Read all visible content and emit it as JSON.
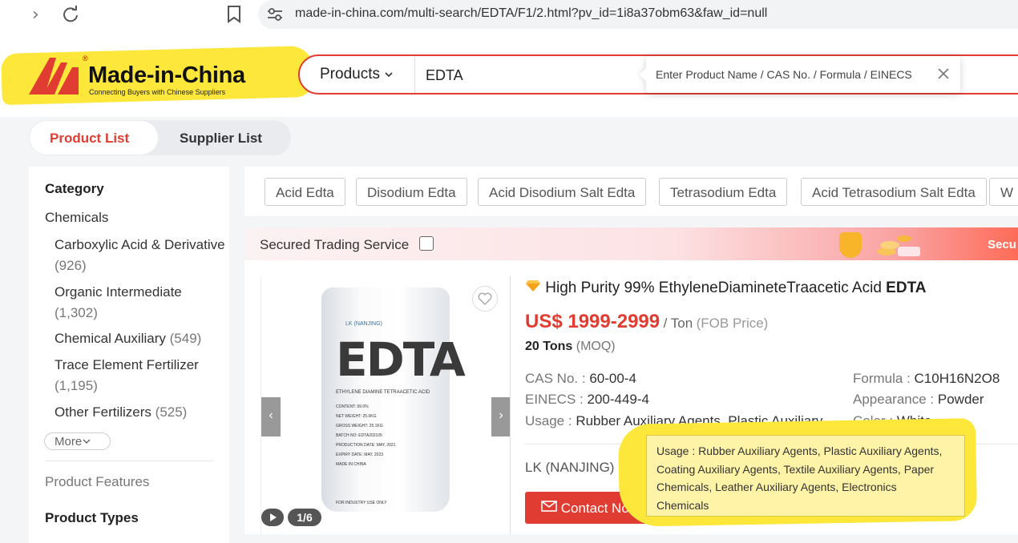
{
  "browser": {
    "url": "made-in-china.com/multi-search/EDTA/F1/2.html?pv_id=1i8a37obm63&faw_id=null"
  },
  "header": {
    "logo_text": "Made-in-China",
    "logo_reg": "®",
    "logo_sub": "Connecting Buyers with Chinese Suppliers",
    "search_category": "Products",
    "search_query": "EDTA",
    "search_tip": "Enter Product Name / CAS No. / Formula / EINECS"
  },
  "tabs": {
    "product_list": "Product List",
    "supplier_list": "Supplier List"
  },
  "sidebar": {
    "category_heading": "Category",
    "category": "Chemicals",
    "items": [
      {
        "label": "Carboxylic Acid & Derivative",
        "count": "(926)"
      },
      {
        "label": "Organic Intermediate",
        "count": "(1,302)"
      },
      {
        "label": "Chemical Auxiliary",
        "count": "(549)"
      },
      {
        "label": "Trace Element Fertilizer",
        "count": "(1,195)"
      },
      {
        "label": "Other Fertilizers",
        "count": "(525)"
      }
    ],
    "more": "More",
    "product_features": "Product Features",
    "product_types": "Product Types"
  },
  "chips": [
    "Acid Edta",
    "Disodium Edta",
    "Acid Disodium Salt Edta",
    "Tetrasodium Edta",
    "Acid Tetrasodium Salt Edta",
    "W"
  ],
  "secured": {
    "label": "Secured Trading Service",
    "banner": "Secu"
  },
  "product": {
    "title": "High Purity 99% EthyleneDiamineteTraacetic Acid",
    "title_bold": "EDTA",
    "price": "US$ 1999-2999",
    "unit": "/ Ton",
    "price_type": "(FOB Price)",
    "moq_qty": "20 Tons",
    "moq_label": "(MOQ)",
    "cas_key": "CAS No. :",
    "cas_val": "60-00-4",
    "einecs_key": "EINECS :",
    "einecs_val": "200-449-4",
    "usage_key": "Usage :",
    "usage_val": "Rubber Auxiliary Agents, Plastic Auxiliary ...",
    "formula_key": "Formula :",
    "formula_val": "C10H16N2O8",
    "appearance_key": "Appearance :",
    "appearance_val": "Powder",
    "color_key": "Color :",
    "color_val": "White",
    "company": "LK (NANJING) CO.,",
    "contact": "Contact Now",
    "image_counter": "1/6",
    "bag_brand": "LK (NANJING)",
    "bag_big": "EDTA",
    "bag_sub": "ETHYLENE DIAMINE TETRAACETIC ACID",
    "bag_rows": [
      "CONTENT:  99.0%",
      "NET WEIGHT:  25.0KG",
      "GROSS WEIGHT:  25.1KG",
      "BATCH NO:  EDTA202105",
      "PRODUCTION DATE:  MAY, 2021",
      "EXPIRY DATE:  MAY, 2023",
      "MADE IN CHINA"
    ],
    "bag_foot": "FOR INDUSTRY USE ONLY"
  },
  "usage_popup": "Usage : Rubber Auxiliary Agents, Plastic Auxiliary Agents, Coating Auxiliary Agents, Textile Auxiliary Agents, Paper Chemicals, Leather Auxiliary Agents, Electronics Chemicals",
  "colors": {
    "accent": "#e03c31",
    "highlight": "#fde73a"
  }
}
